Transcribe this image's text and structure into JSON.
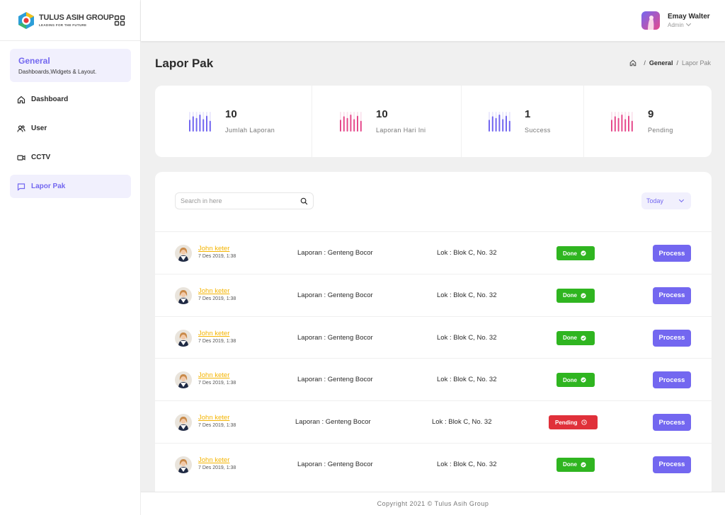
{
  "brand": {
    "title": "TULUS ASIH GROUP",
    "tagline": "LEADING FOR THE FUTURE",
    "colors": [
      "#2c9ed8",
      "#f4c21b",
      "#e8383d",
      "#3cb371"
    ]
  },
  "sidebar": {
    "section_title": "General",
    "section_subtitle": "Dashboards,Widgets & Layout.",
    "items": [
      {
        "label": "Dashboard",
        "icon": "home-icon"
      },
      {
        "label": "User",
        "icon": "users-icon"
      },
      {
        "label": "CCTV",
        "icon": "video-icon"
      },
      {
        "label": "Lapor Pak",
        "icon": "message-icon",
        "active": true
      }
    ]
  },
  "header": {
    "user_name": "Emay Walter",
    "user_role": "Admin"
  },
  "page": {
    "title": "Lapor Pak",
    "breadcrumb": [
      "General",
      "Lapor Pak"
    ]
  },
  "stats": [
    {
      "value": "10",
      "label": "Jumlah Laporan",
      "color": "#7367f0"
    },
    {
      "value": "10",
      "label": "Laporan Hari Ini",
      "color": "#e64a8c"
    },
    {
      "value": "1",
      "label": "Success",
      "color": "#7367f0"
    },
    {
      "value": "9",
      "label": "Pending",
      "color": "#e64a8c"
    }
  ],
  "table": {
    "search_placeholder": "Search in here",
    "filter_value": "Today",
    "process_label": "Process",
    "rows": [
      {
        "name": "John keter",
        "date": "7 Des 2019, 1:38",
        "report": "Laporan : Genteng Bocor",
        "location": "Lok : Blok C, No. 32",
        "status": "Done"
      },
      {
        "name": "John keter",
        "date": "7 Des 2019, 1:38",
        "report": "Laporan : Genteng Bocor",
        "location": "Lok : Blok C, No. 32",
        "status": "Done"
      },
      {
        "name": "John keter",
        "date": "7 Des 2019, 1:38",
        "report": "Laporan : Genteng Bocor",
        "location": "Lok : Blok C, No. 32",
        "status": "Done"
      },
      {
        "name": "John keter",
        "date": "7 Des 2019, 1:38",
        "report": "Laporan : Genteng Bocor",
        "location": "Lok : Blok C, No. 32",
        "status": "Done"
      },
      {
        "name": "John keter",
        "date": "7 Des 2019, 1:38",
        "report": "Laporan : Genteng Bocor",
        "location": "Lok : Blok C, No. 32",
        "status": "Pending"
      },
      {
        "name": "John keter",
        "date": "7 Des 2019, 1:38",
        "report": "Laporan : Genteng Bocor",
        "location": "Lok : Blok C, No. 32",
        "status": "Done"
      }
    ]
  },
  "footer": {
    "text": "Copyright 2021 © Tulus Asih Group"
  }
}
